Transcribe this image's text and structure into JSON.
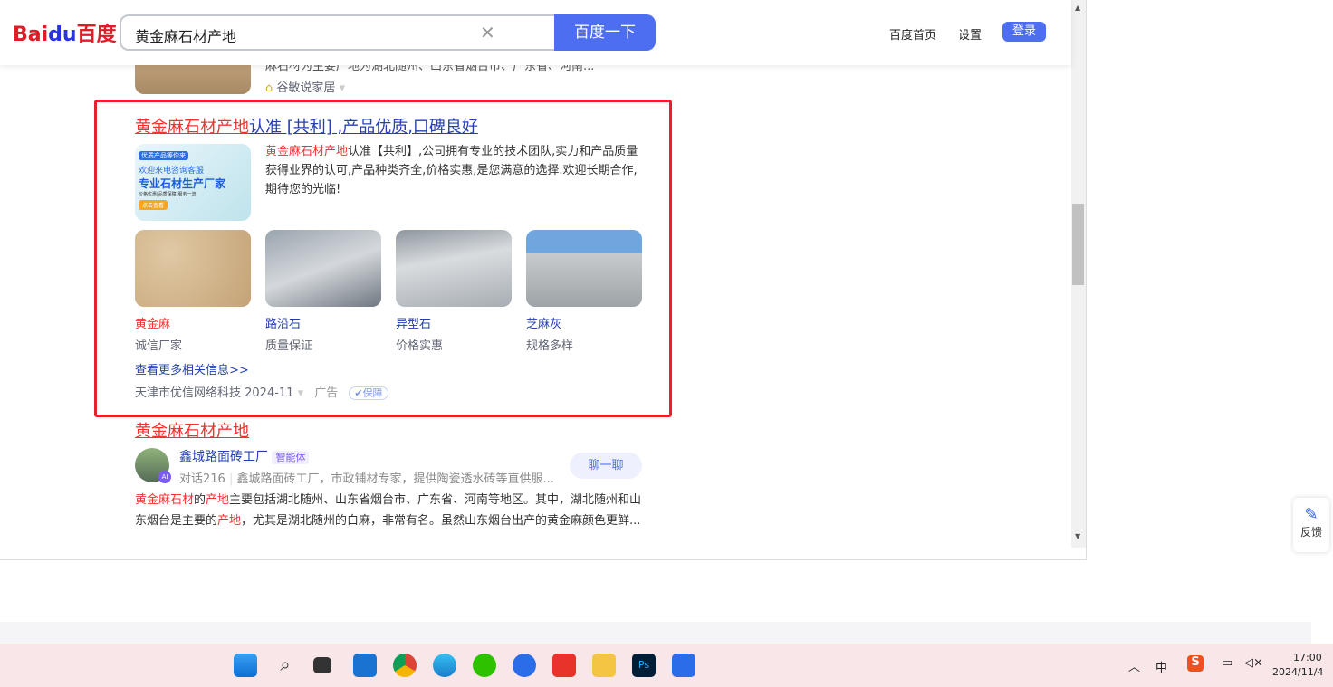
{
  "header": {
    "logo_bai": "Bai",
    "logo_du": "du",
    "logo_cn": "百度",
    "query": "黄金麻石材产地",
    "search_button": "百度一下",
    "links": [
      "百度首页",
      "设置"
    ],
    "login": "登录"
  },
  "prev_result": {
    "snippet": "麻石材为主要产地为湖北随州、山东省烟台市、广东省、河南...",
    "source": "谷敏说家居"
  },
  "ad": {
    "title_red": "黄金麻石材产地",
    "title_rest": "认准 [共利] ,产品优质,口碑良好",
    "thumb_tag": "优质产品等你来",
    "thumb_line1": "欢迎来电咨询客服",
    "thumb_line2": "专业石材生产厂家",
    "thumb_line3": "价格优惠|品质保障|服务一流",
    "thumb_btn": "点击查看",
    "desc_red": "黄金麻石材产地",
    "desc": "认准【共利】,公司拥有专业的技术团队,实力和产品质量获得业界的认可,产品种类齐全,价格实惠,是您满意的选择.欢迎长期合作,期待您的光临!",
    "products": [
      {
        "name": "黄金麻",
        "sub": "诚信厂家"
      },
      {
        "name": "路沿石",
        "sub": "质量保证"
      },
      {
        "name": "异型石",
        "sub": "价格实惠"
      },
      {
        "name": "芝麻灰",
        "sub": "规格多样"
      }
    ],
    "more": "查看更多相关信息>>",
    "source": "天津市优信网络科技 2024-11",
    "ad_label": "广告",
    "badge": "保障"
  },
  "ai_result": {
    "title": "黄金麻石材产地",
    "agent": "鑫城路面砖工厂",
    "agent_tag": "智能体",
    "chats": "对话216",
    "agent_desc": "鑫城路面砖工厂，市政铺材专家，提供陶瓷透水砖等直供服...",
    "chat_button": "聊一聊",
    "s1": "黄金麻石材",
    "s2": "的",
    "s3": "产地",
    "s4": "主要包括湖北随州、山东省烟台市、广东省、河南等地区。其中，湖北随州和山东烟台是主要的",
    "s5": "产地",
    "s6": "，尤其是湖北随州的白麻，非常有名。虽然山东烟台出产的黄金麻颜色更鲜..."
  },
  "feedback": "反馈",
  "tray": {
    "ime": "中",
    "time": "17:00",
    "date": "2024/11/4"
  }
}
